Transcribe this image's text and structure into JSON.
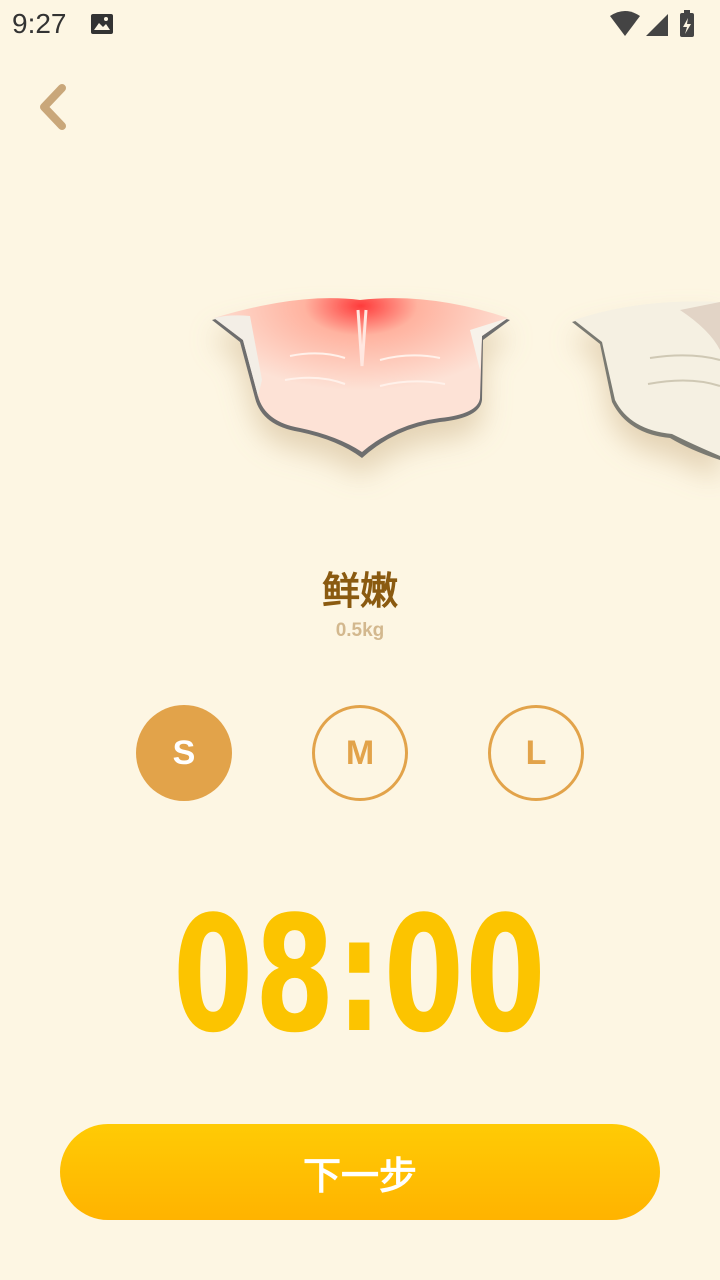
{
  "status_bar": {
    "time": "9:27"
  },
  "meat": {
    "name": "鲜嫩",
    "weight": "0.5kg"
  },
  "sizes": [
    {
      "label": "S",
      "selected": true
    },
    {
      "label": "M",
      "selected": false
    },
    {
      "label": "L",
      "selected": false
    }
  ],
  "timer": {
    "value": "08:00"
  },
  "next_button": {
    "label": "下一步"
  },
  "colors": {
    "background": "#fdf6e3",
    "accent": "#e2a34a",
    "timer": "#fcc400",
    "title": "#8a5a10"
  }
}
